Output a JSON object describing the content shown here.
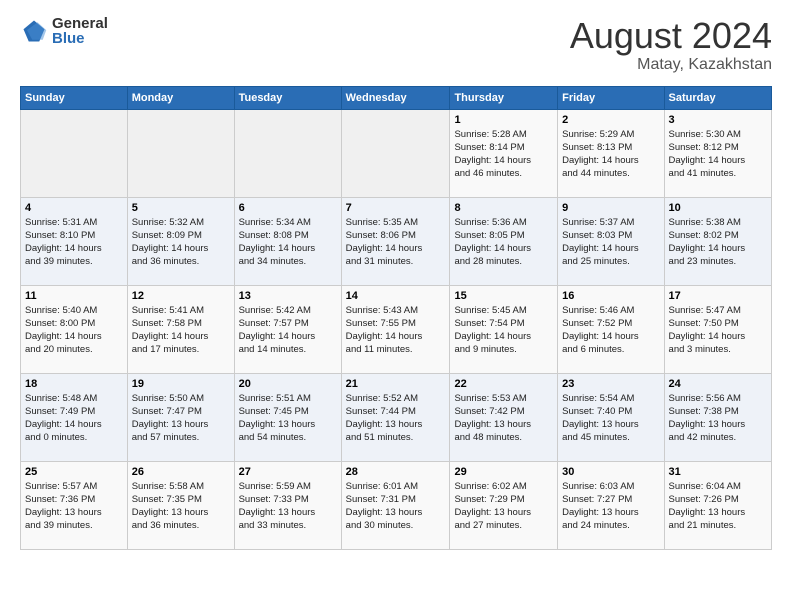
{
  "logo": {
    "general": "General",
    "blue": "Blue"
  },
  "title": "August 2024",
  "location": "Matay, Kazakhstan",
  "days_of_week": [
    "Sunday",
    "Monday",
    "Tuesday",
    "Wednesday",
    "Thursday",
    "Friday",
    "Saturday"
  ],
  "weeks": [
    [
      {
        "day": "",
        "info": ""
      },
      {
        "day": "",
        "info": ""
      },
      {
        "day": "",
        "info": ""
      },
      {
        "day": "",
        "info": ""
      },
      {
        "day": "1",
        "info": "Sunrise: 5:28 AM\nSunset: 8:14 PM\nDaylight: 14 hours\nand 46 minutes."
      },
      {
        "day": "2",
        "info": "Sunrise: 5:29 AM\nSunset: 8:13 PM\nDaylight: 14 hours\nand 44 minutes."
      },
      {
        "day": "3",
        "info": "Sunrise: 5:30 AM\nSunset: 8:12 PM\nDaylight: 14 hours\nand 41 minutes."
      }
    ],
    [
      {
        "day": "4",
        "info": "Sunrise: 5:31 AM\nSunset: 8:10 PM\nDaylight: 14 hours\nand 39 minutes."
      },
      {
        "day": "5",
        "info": "Sunrise: 5:32 AM\nSunset: 8:09 PM\nDaylight: 14 hours\nand 36 minutes."
      },
      {
        "day": "6",
        "info": "Sunrise: 5:34 AM\nSunset: 8:08 PM\nDaylight: 14 hours\nand 34 minutes."
      },
      {
        "day": "7",
        "info": "Sunrise: 5:35 AM\nSunset: 8:06 PM\nDaylight: 14 hours\nand 31 minutes."
      },
      {
        "day": "8",
        "info": "Sunrise: 5:36 AM\nSunset: 8:05 PM\nDaylight: 14 hours\nand 28 minutes."
      },
      {
        "day": "9",
        "info": "Sunrise: 5:37 AM\nSunset: 8:03 PM\nDaylight: 14 hours\nand 25 minutes."
      },
      {
        "day": "10",
        "info": "Sunrise: 5:38 AM\nSunset: 8:02 PM\nDaylight: 14 hours\nand 23 minutes."
      }
    ],
    [
      {
        "day": "11",
        "info": "Sunrise: 5:40 AM\nSunset: 8:00 PM\nDaylight: 14 hours\nand 20 minutes."
      },
      {
        "day": "12",
        "info": "Sunrise: 5:41 AM\nSunset: 7:58 PM\nDaylight: 14 hours\nand 17 minutes."
      },
      {
        "day": "13",
        "info": "Sunrise: 5:42 AM\nSunset: 7:57 PM\nDaylight: 14 hours\nand 14 minutes."
      },
      {
        "day": "14",
        "info": "Sunrise: 5:43 AM\nSunset: 7:55 PM\nDaylight: 14 hours\nand 11 minutes."
      },
      {
        "day": "15",
        "info": "Sunrise: 5:45 AM\nSunset: 7:54 PM\nDaylight: 14 hours\nand 9 minutes."
      },
      {
        "day": "16",
        "info": "Sunrise: 5:46 AM\nSunset: 7:52 PM\nDaylight: 14 hours\nand 6 minutes."
      },
      {
        "day": "17",
        "info": "Sunrise: 5:47 AM\nSunset: 7:50 PM\nDaylight: 14 hours\nand 3 minutes."
      }
    ],
    [
      {
        "day": "18",
        "info": "Sunrise: 5:48 AM\nSunset: 7:49 PM\nDaylight: 14 hours\nand 0 minutes."
      },
      {
        "day": "19",
        "info": "Sunrise: 5:50 AM\nSunset: 7:47 PM\nDaylight: 13 hours\nand 57 minutes."
      },
      {
        "day": "20",
        "info": "Sunrise: 5:51 AM\nSunset: 7:45 PM\nDaylight: 13 hours\nand 54 minutes."
      },
      {
        "day": "21",
        "info": "Sunrise: 5:52 AM\nSunset: 7:44 PM\nDaylight: 13 hours\nand 51 minutes."
      },
      {
        "day": "22",
        "info": "Sunrise: 5:53 AM\nSunset: 7:42 PM\nDaylight: 13 hours\nand 48 minutes."
      },
      {
        "day": "23",
        "info": "Sunrise: 5:54 AM\nSunset: 7:40 PM\nDaylight: 13 hours\nand 45 minutes."
      },
      {
        "day": "24",
        "info": "Sunrise: 5:56 AM\nSunset: 7:38 PM\nDaylight: 13 hours\nand 42 minutes."
      }
    ],
    [
      {
        "day": "25",
        "info": "Sunrise: 5:57 AM\nSunset: 7:36 PM\nDaylight: 13 hours\nand 39 minutes."
      },
      {
        "day": "26",
        "info": "Sunrise: 5:58 AM\nSunset: 7:35 PM\nDaylight: 13 hours\nand 36 minutes."
      },
      {
        "day": "27",
        "info": "Sunrise: 5:59 AM\nSunset: 7:33 PM\nDaylight: 13 hours\nand 33 minutes."
      },
      {
        "day": "28",
        "info": "Sunrise: 6:01 AM\nSunset: 7:31 PM\nDaylight: 13 hours\nand 30 minutes."
      },
      {
        "day": "29",
        "info": "Sunrise: 6:02 AM\nSunset: 7:29 PM\nDaylight: 13 hours\nand 27 minutes."
      },
      {
        "day": "30",
        "info": "Sunrise: 6:03 AM\nSunset: 7:27 PM\nDaylight: 13 hours\nand 24 minutes."
      },
      {
        "day": "31",
        "info": "Sunrise: 6:04 AM\nSunset: 7:26 PM\nDaylight: 13 hours\nand 21 minutes."
      }
    ]
  ]
}
